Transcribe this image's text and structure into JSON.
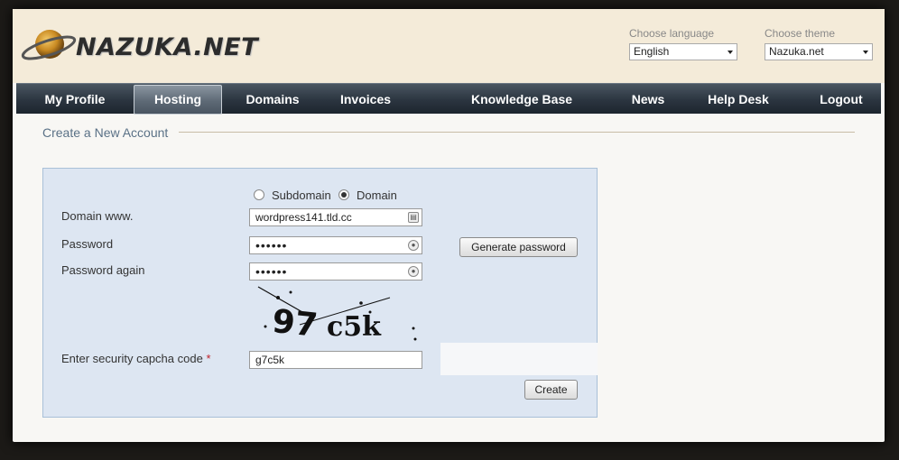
{
  "header": {
    "logo_text": "NAZUKA.NET",
    "language_label": "Choose language",
    "language_value": "English",
    "theme_label": "Choose theme",
    "theme_value": "Nazuka.net"
  },
  "nav": {
    "items": [
      {
        "label": "My Profile",
        "active": false
      },
      {
        "label": "Hosting",
        "active": true
      },
      {
        "label": "Domains",
        "active": false
      },
      {
        "label": "Invoices",
        "active": false
      },
      {
        "label": "Knowledge Base",
        "active": false
      },
      {
        "label": "News",
        "active": false
      },
      {
        "label": "Help Desk",
        "active": false
      },
      {
        "label": "Logout",
        "active": false
      }
    ]
  },
  "main": {
    "section_title": "Create a New Account",
    "form": {
      "type_options": [
        {
          "label": "Subdomain",
          "selected": false
        },
        {
          "label": "Domain",
          "selected": true
        }
      ],
      "domain_label": "Domain www.",
      "domain_value": "wordpress141.tld.cc",
      "password_label": "Password",
      "password_value": "••••••",
      "password_again_label": "Password again",
      "password_again_value": "••••••",
      "generate_button": "Generate password",
      "captcha_label": "Enter security capcha code",
      "captcha_required_mark": "*",
      "captcha_image_text": "97c5k",
      "captcha_value": "g7c5k",
      "create_button": "Create"
    }
  },
  "colors": {
    "nav_bg": "#2b3540",
    "header_bg": "#f4ebd9",
    "panel_bg": "#dde6f2",
    "required": "#c0202a"
  }
}
